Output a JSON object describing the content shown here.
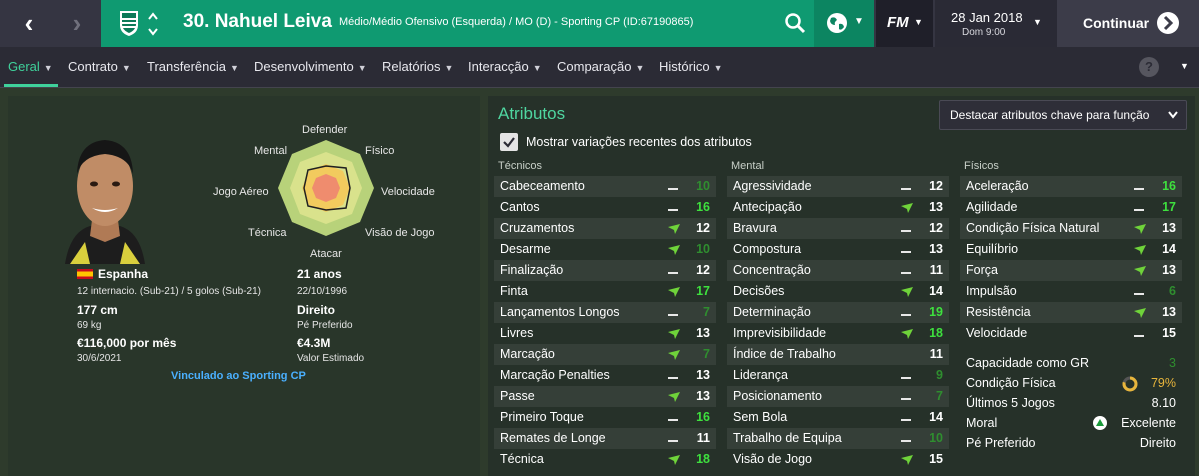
{
  "nav": {
    "back_glyph": "‹",
    "forward_glyph": "›"
  },
  "header": {
    "player_title": "30. Nahuel Leiva",
    "player_subtitle": "Médio/Médio Ofensivo (Esquerda) / MO (D) - Sporting CP (ID:67190865)"
  },
  "fm_label": "FM",
  "date": {
    "date": "28 Jan 2018",
    "day_time": "Dom 9:00"
  },
  "continue_label": "Continuar",
  "menu": [
    "Geral",
    "Contrato",
    "Transferência",
    "Desenvolvimento",
    "Relatórios",
    "Interacção",
    "Comparação",
    "Histórico"
  ],
  "help_label": "?",
  "profile": {
    "country": "Espanha",
    "intl": "12 internacio. (Sub-21) / 5 golos (Sub-21)",
    "height": "177 cm",
    "weight": "69 kg",
    "wage": "€116,000 por mês",
    "contract_end": "30/6/2021",
    "age": "21 anos",
    "dob": "22/10/1996",
    "foot": "Direito",
    "foot_label": "Pé Preferido",
    "value": "€4.3M",
    "value_label": "Valor Estimado",
    "link": "Vinculado ao Sporting CP"
  },
  "radar": {
    "labels": [
      "Defender",
      "Físico",
      "Velocidade",
      "Visão de Jogo",
      "Atacar",
      "Técnica",
      "Jogo Aéreo",
      "Mental"
    ]
  },
  "attributes_panel": {
    "title": "Atributos",
    "highlight_dropdown": "Destacar atributos chave para função",
    "show_changes_label": "Mostrar variações recentes dos atributos",
    "show_changes_checked": true
  },
  "tecnicos": {
    "title": "Técnicos",
    "rows": [
      {
        "name": "Cabeceamento",
        "ind": "dash",
        "value": "10",
        "color": "dim"
      },
      {
        "name": "Cantos",
        "ind": "dash",
        "value": "16",
        "color": "green"
      },
      {
        "name": "Cruzamentos",
        "ind": "up",
        "value": "12",
        "color": "white"
      },
      {
        "name": "Desarme",
        "ind": "up",
        "value": "10",
        "color": "dim"
      },
      {
        "name": "Finalização",
        "ind": "dash",
        "value": "12",
        "color": "white"
      },
      {
        "name": "Finta",
        "ind": "up",
        "value": "17",
        "color": "green"
      },
      {
        "name": "Lançamentos Longos",
        "ind": "dash",
        "value": "7",
        "color": "dim"
      },
      {
        "name": "Livres",
        "ind": "up",
        "value": "13",
        "color": "white"
      },
      {
        "name": "Marcação",
        "ind": "up",
        "value": "7",
        "color": "dim"
      },
      {
        "name": "Marcação Penalties",
        "ind": "dash",
        "value": "13",
        "color": "white"
      },
      {
        "name": "Passe",
        "ind": "up",
        "value": "13",
        "color": "white"
      },
      {
        "name": "Primeiro Toque",
        "ind": "dash",
        "value": "16",
        "color": "green"
      },
      {
        "name": "Remates de Longe",
        "ind": "dash",
        "value": "11",
        "color": "white"
      },
      {
        "name": "Técnica",
        "ind": "up",
        "value": "18",
        "color": "green"
      }
    ]
  },
  "mental": {
    "title": "Mental",
    "rows": [
      {
        "name": "Agressividade",
        "ind": "dash",
        "value": "12",
        "color": "white"
      },
      {
        "name": "Antecipação",
        "ind": "up",
        "value": "13",
        "color": "white"
      },
      {
        "name": "Bravura",
        "ind": "dash",
        "value": "12",
        "color": "white"
      },
      {
        "name": "Compostura",
        "ind": "dash",
        "value": "13",
        "color": "white"
      },
      {
        "name": "Concentração",
        "ind": "dash",
        "value": "11",
        "color": "white"
      },
      {
        "name": "Decisões",
        "ind": "up",
        "value": "14",
        "color": "white"
      },
      {
        "name": "Determinação",
        "ind": "dash",
        "value": "19",
        "color": "green"
      },
      {
        "name": "Imprevisibilidade",
        "ind": "up",
        "value": "18",
        "color": "green"
      },
      {
        "name": "Índice de Trabalho",
        "ind": "none",
        "value": "11",
        "color": "white"
      },
      {
        "name": "Liderança",
        "ind": "dash",
        "value": "9",
        "color": "dim"
      },
      {
        "name": "Posicionamento",
        "ind": "dash",
        "value": "7",
        "color": "dim"
      },
      {
        "name": "Sem Bola",
        "ind": "dash",
        "value": "14",
        "color": "white"
      },
      {
        "name": "Trabalho de Equipa",
        "ind": "dash",
        "value": "10",
        "color": "dim"
      },
      {
        "name": "Visão de Jogo",
        "ind": "up",
        "value": "15",
        "color": "white"
      }
    ]
  },
  "fisicos": {
    "title": "Físicos",
    "rows": [
      {
        "name": "Aceleração",
        "ind": "dash",
        "value": "16",
        "color": "green"
      },
      {
        "name": "Agilidade",
        "ind": "dash",
        "value": "17",
        "color": "green"
      },
      {
        "name": "Condição Física Natural",
        "ind": "up",
        "value": "13",
        "color": "white"
      },
      {
        "name": "Equilíbrio",
        "ind": "up",
        "value": "14",
        "color": "white"
      },
      {
        "name": "Força",
        "ind": "up",
        "value": "13",
        "color": "white"
      },
      {
        "name": "Impulsão",
        "ind": "dash",
        "value": "6",
        "color": "dim"
      },
      {
        "name": "Resistência",
        "ind": "up",
        "value": "13",
        "color": "white"
      },
      {
        "name": "Velocidade",
        "ind": "dash",
        "value": "15",
        "color": "white"
      }
    ]
  },
  "summary": [
    {
      "label": "Capacidade como GR",
      "value": "3"
    },
    {
      "label": "Condição Física",
      "value": "79%",
      "fitness_fraction": 0.79
    },
    {
      "label": "Últimos 5 Jogos",
      "value": "8.10"
    },
    {
      "label": "Moral",
      "value": "Excelente"
    },
    {
      "label": "Pé Preferido",
      "value": "Direito"
    }
  ],
  "colors": {
    "teal": "#0f9a71",
    "green_value": "#3ee03e",
    "dim_value": "#2f8e2f",
    "arrow": "#6fd33a",
    "link": "#4ab0ff",
    "fitness": "#e7b53c"
  }
}
